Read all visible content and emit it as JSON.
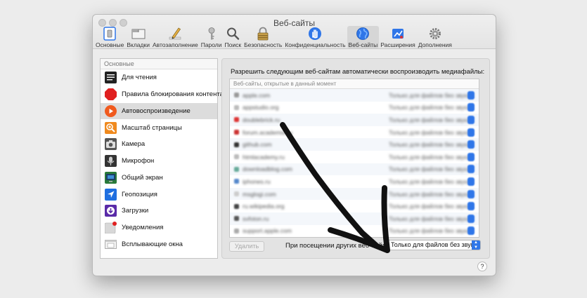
{
  "window": {
    "title": "Веб-сайты"
  },
  "toolbar": {
    "items": [
      {
        "label": "Основные",
        "icon": "switch-icon"
      },
      {
        "label": "Вкладки",
        "icon": "tabs-icon"
      },
      {
        "label": "Автозаполнение",
        "icon": "pencil-icon"
      },
      {
        "label": "Пароли",
        "icon": "key-icon"
      },
      {
        "label": "Поиск",
        "icon": "magnifier-icon"
      },
      {
        "label": "Безопасность",
        "icon": "padlock-icon"
      },
      {
        "label": "Конфиденциальность",
        "icon": "hand-icon"
      },
      {
        "label": "Веб-сайты",
        "icon": "globe-icon"
      },
      {
        "label": "Расширения",
        "icon": "puzzle-icon"
      },
      {
        "label": "Дополнения",
        "icon": "gear-icon"
      }
    ],
    "active": "Веб-сайты"
  },
  "sidebar": {
    "header": "Основные",
    "selected": "Автовоспроизведение",
    "items": [
      {
        "label": "Для чтения",
        "icon": "reader-icon"
      },
      {
        "label": "Правила блокирования контента",
        "icon": "stop-sign-icon"
      },
      {
        "label": "Автовоспроизведение",
        "icon": "play-icon"
      },
      {
        "label": "Масштаб страницы",
        "icon": "zoom-icon"
      },
      {
        "label": "Камера",
        "icon": "camera-icon"
      },
      {
        "label": "Микрофон",
        "icon": "microphone-icon"
      },
      {
        "label": "Общий экран",
        "icon": "screen-share-icon"
      },
      {
        "label": "Геопозиция",
        "icon": "location-icon"
      },
      {
        "label": "Загрузки",
        "icon": "download-icon"
      },
      {
        "label": "Уведомления",
        "icon": "notification-icon"
      },
      {
        "label": "Всплывающие окна",
        "icon": "popup-window-icon"
      }
    ]
  },
  "content": {
    "description": "Разрешить следующим веб-сайтам автоматически воспроизводить медиафайлы:",
    "list_header": "Веб-сайты, открытые в данный момент",
    "sites": [
      {
        "domain": "apple.com",
        "setting": "Только для файлов без звука"
      },
      {
        "domain": "appstudio.org",
        "setting": "Только для файлов без звука"
      },
      {
        "domain": "doublebrick.ru",
        "setting": "Только для файлов без звука"
      },
      {
        "domain": "forum.academia.ru",
        "setting": "Только для файлов без звука"
      },
      {
        "domain": "github.com",
        "setting": "Только для файлов без звука"
      },
      {
        "domain": "htmlacademy.ru",
        "setting": "Только для файлов без звука"
      },
      {
        "domain": "downloadblog.com",
        "setting": "Только для файлов без звука"
      },
      {
        "domain": "iphones.ru",
        "setting": "Только для файлов без звука"
      },
      {
        "domain": "msglogi.com",
        "setting": "Только для файлов без звука"
      },
      {
        "domain": "ru.wikipedia.org",
        "setting": "Только для файлов без звука"
      },
      {
        "domain": "svfoton.ru",
        "setting": "Только для файлов без звука"
      },
      {
        "domain": "support.apple.com",
        "setting": "Только для файлов без звука"
      }
    ],
    "delete_button": "Удалить",
    "other_sites_label": "При посещении других веб-сайтов:",
    "other_sites_value": "Только для файлов без звука",
    "help": "?"
  },
  "colors": {
    "accent": "#2f76e8",
    "arrow": "#111111",
    "selection": "#dcdcdc"
  }
}
